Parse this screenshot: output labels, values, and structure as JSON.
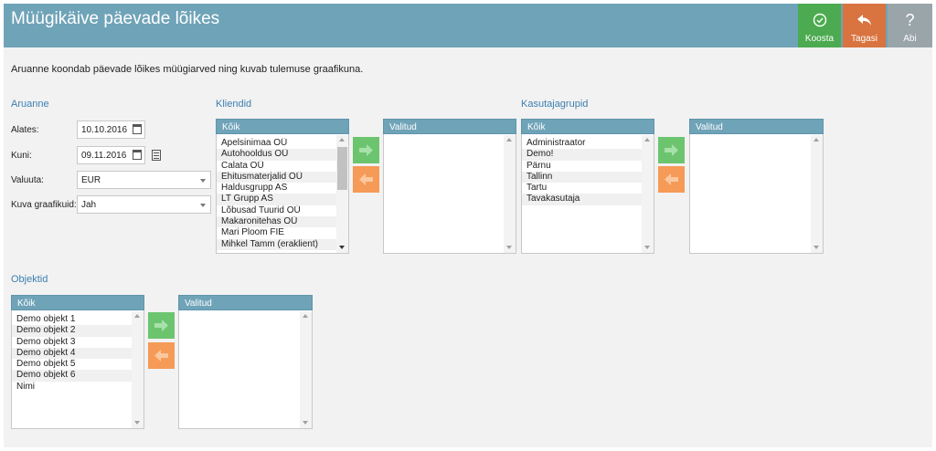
{
  "header": {
    "title": "Müügikäive päevade lõikes",
    "buttons": {
      "koosta": "Koosta",
      "tagasi": "Tagasi",
      "abi": "Abi",
      "abi_glyph": "?"
    },
    "colors": {
      "bar": "#6fa3b8",
      "koosta": "#4caa50",
      "tagasi": "#d9733f",
      "abi": "#9aa5aa"
    }
  },
  "intro": "Aruanne koondab päevade lõikes müügiarved ning kuvab tulemuse graafikuna.",
  "report": {
    "title": "Aruanne",
    "fields": {
      "alates_label": "Alates:",
      "alates_value": "10.10.2016",
      "kuni_label": "Kuni:",
      "kuni_value": "09.11.2016",
      "valuuta_label": "Valuuta:",
      "valuuta_value": "EUR",
      "graafikud_label": "Kuva graafikuid:",
      "graafikud_value": "Jah"
    }
  },
  "kliendid": {
    "title": "Kliendid",
    "all_header": "Kõik",
    "selected_header": "Valitud",
    "items": [
      "Apelsinimaa OÜ",
      "Autohooldus OÜ",
      "Calata OÜ",
      "Ehitusmaterjalid OÜ",
      "Haldusgrupp AS",
      "LT Grupp AS",
      "Lõbusad Tuurid OÜ",
      "Makaronitehas OÜ",
      "Mari Ploom FIE",
      "Mihkel Tamm (eraklient)"
    ]
  },
  "kasutajagrupid": {
    "title": "Kasutajagrupid",
    "all_header": "Kõik",
    "selected_header": "Valitud",
    "items": [
      "Administraator",
      "Demo!",
      "Pärnu",
      "Tallinn",
      "Tartu",
      "Tavakasutaja"
    ]
  },
  "objektid": {
    "title": "Objektid",
    "all_header": "Kõik",
    "selected_header": "Valitud",
    "items": [
      "Demo objekt 1",
      "Demo objekt 2",
      "Demo objekt 3",
      "Demo objekt 4",
      "Demo objekt 5",
      "Demo objekt 6",
      "Nimi"
    ]
  },
  "icons": {
    "add": "arrow-right-icon",
    "remove": "arrow-left-icon",
    "calendar": "calendar-icon",
    "koosta": "check-circle-icon",
    "tagasi": "reply-icon",
    "abi": "question-icon"
  }
}
